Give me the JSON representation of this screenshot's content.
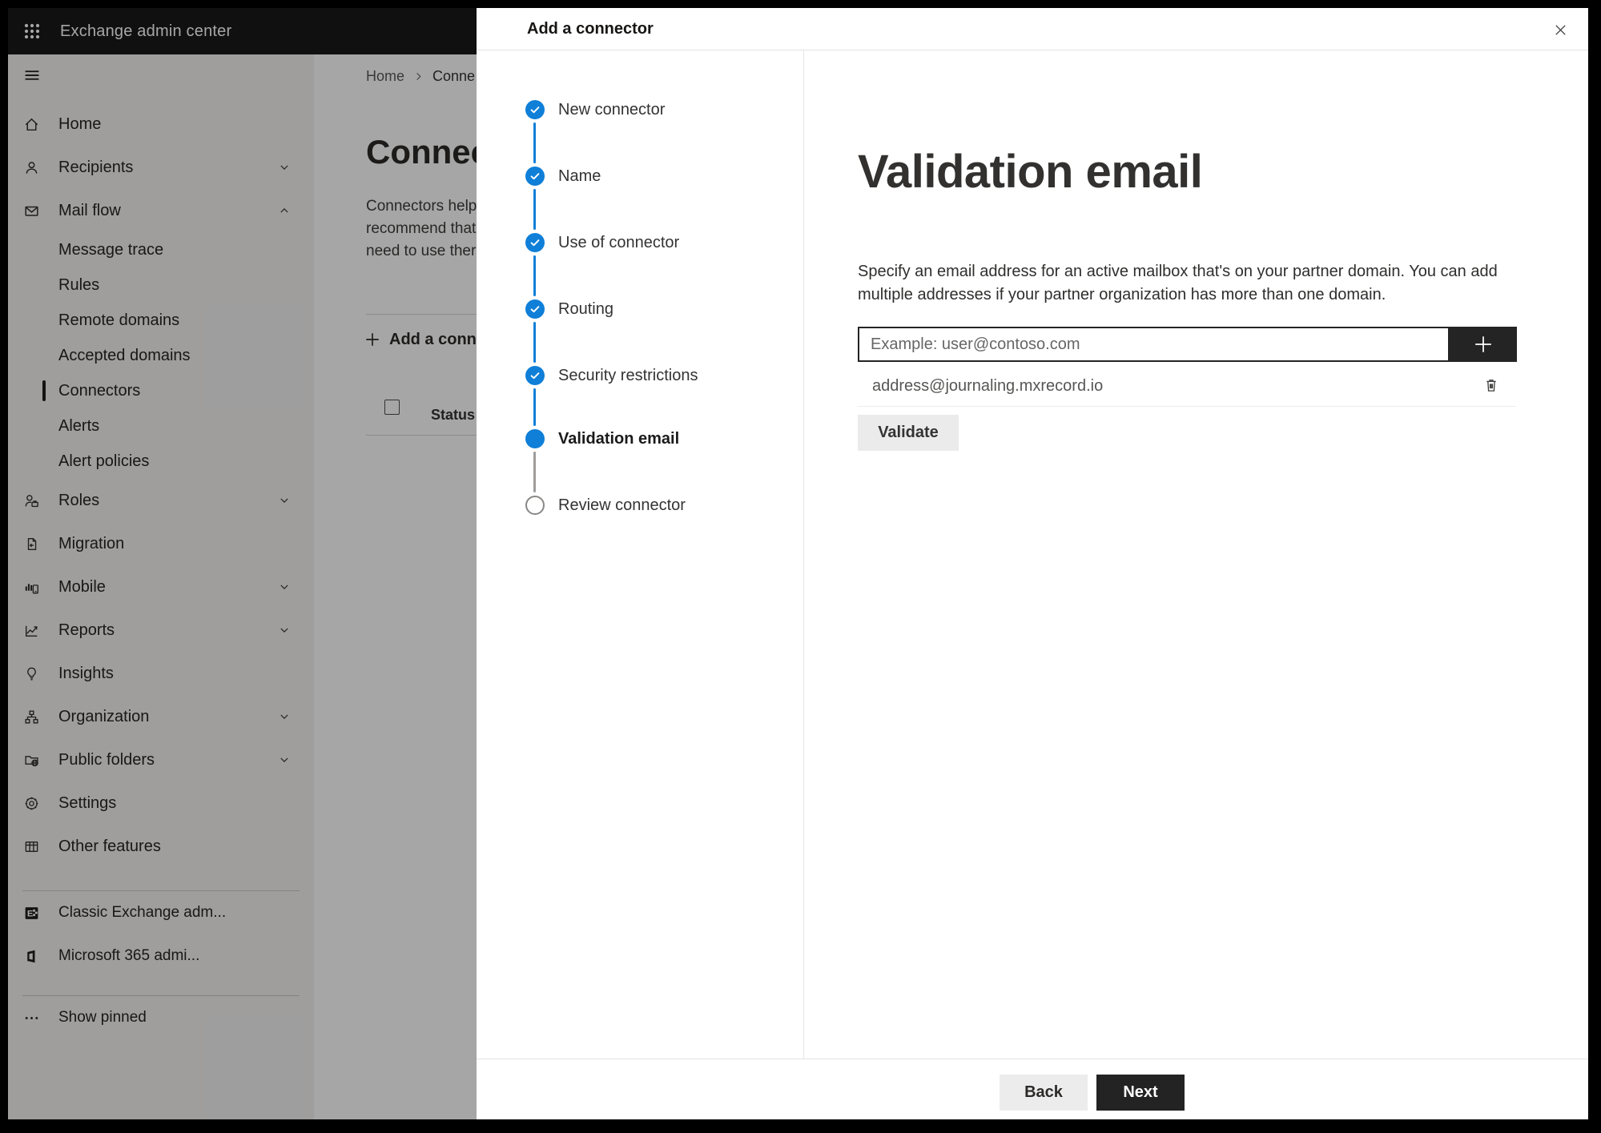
{
  "topbar": {
    "title": "Exchange admin center"
  },
  "sidebar": {
    "items": [
      {
        "label": "Home",
        "icon": "home-icon"
      },
      {
        "label": "Recipients",
        "icon": "person-icon",
        "chevron": "down"
      },
      {
        "label": "Mail flow",
        "icon": "mail-icon",
        "chevron": "up"
      },
      {
        "label": "Message trace",
        "child": true
      },
      {
        "label": "Rules",
        "child": true
      },
      {
        "label": "Remote domains",
        "child": true
      },
      {
        "label": "Accepted domains",
        "child": true
      },
      {
        "label": "Connectors",
        "child": true,
        "selected": true
      },
      {
        "label": "Alerts",
        "child": true
      },
      {
        "label": "Alert policies",
        "child": true
      },
      {
        "label": "Roles",
        "icon": "roles-icon",
        "chevron": "down"
      },
      {
        "label": "Migration",
        "icon": "migration-icon"
      },
      {
        "label": "Mobile",
        "icon": "mobile-chart-icon",
        "chevron": "down"
      },
      {
        "label": "Reports",
        "icon": "line-chart-icon",
        "chevron": "down"
      },
      {
        "label": "Insights",
        "icon": "lightbulb-icon"
      },
      {
        "label": "Organization",
        "icon": "org-chart-icon",
        "chevron": "down"
      },
      {
        "label": "Public folders",
        "icon": "folder-globe-icon",
        "chevron": "down"
      },
      {
        "label": "Settings",
        "icon": "gear-icon"
      },
      {
        "label": "Other features",
        "icon": "grid-icon"
      }
    ],
    "footer_items": [
      {
        "label": "Classic Exchange adm...",
        "icon": "classic-exchange-icon"
      },
      {
        "label": "Microsoft 365 admi...",
        "icon": "microsoft-365-icon"
      }
    ],
    "show_pinned": {
      "label": "Show pinned",
      "icon": "ellipsis-icon"
    }
  },
  "page": {
    "breadcrumb": {
      "home": "Home",
      "current": "Conne"
    },
    "title": "Connec",
    "intro_lines": [
      "Connectors help",
      "recommend that",
      "need to use ther"
    ],
    "add_connector_button": "Add a conn",
    "status_column": "Status"
  },
  "wizard": {
    "title": "Add a connector",
    "steps": [
      {
        "label": "New connector",
        "state": "complete"
      },
      {
        "label": "Name",
        "state": "complete"
      },
      {
        "label": "Use of connector",
        "state": "complete"
      },
      {
        "label": "Routing",
        "state": "complete"
      },
      {
        "label": "Security restrictions",
        "state": "complete"
      },
      {
        "label": "Validation email",
        "state": "current"
      },
      {
        "label": "Review connector",
        "state": "upcoming"
      }
    ]
  },
  "validation": {
    "heading": "Validation email",
    "description_lines": [
      "Specify an email address for an active mailbox that's on your partner domain. You can add",
      "multiple addresses if your partner organization has more than one domain."
    ],
    "email_placeholder": "Example: user@contoso.com",
    "addresses": [
      "address@journaling.mxrecord.io"
    ],
    "validate_button": "Validate"
  },
  "modal_footer": {
    "back_button": "Back",
    "next_button": "Next"
  },
  "colors": {
    "accent_blue": "#0f7fd8",
    "dark_button": "#242424",
    "topbar_bg": "#1b1a19",
    "overlay": "rgba(0,0,0,0.35)"
  }
}
